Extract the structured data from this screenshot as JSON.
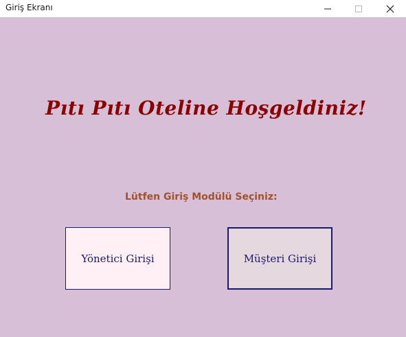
{
  "window": {
    "title": "Giriş Ekranı",
    "controls": [
      "minimize-icon",
      "maximize-icon",
      "close-icon"
    ]
  },
  "main": {
    "welcome_text": "Pıtı Pıtı Oteline Hoşgeldiniz!",
    "prompt_text": "Lütfen Giriş Modülü Seçiniz:",
    "admin_button_label": "Yönetici Girişi",
    "customer_button_label": "Müşteri Girişi"
  },
  "colors": {
    "background": "#d8bfd8",
    "welcome_text": "#8b0000",
    "prompt_text": "#a0522d",
    "button_text": "#191970",
    "admin_button_bg": "#fff0f5",
    "customer_button_bg": "#e6d8df"
  }
}
